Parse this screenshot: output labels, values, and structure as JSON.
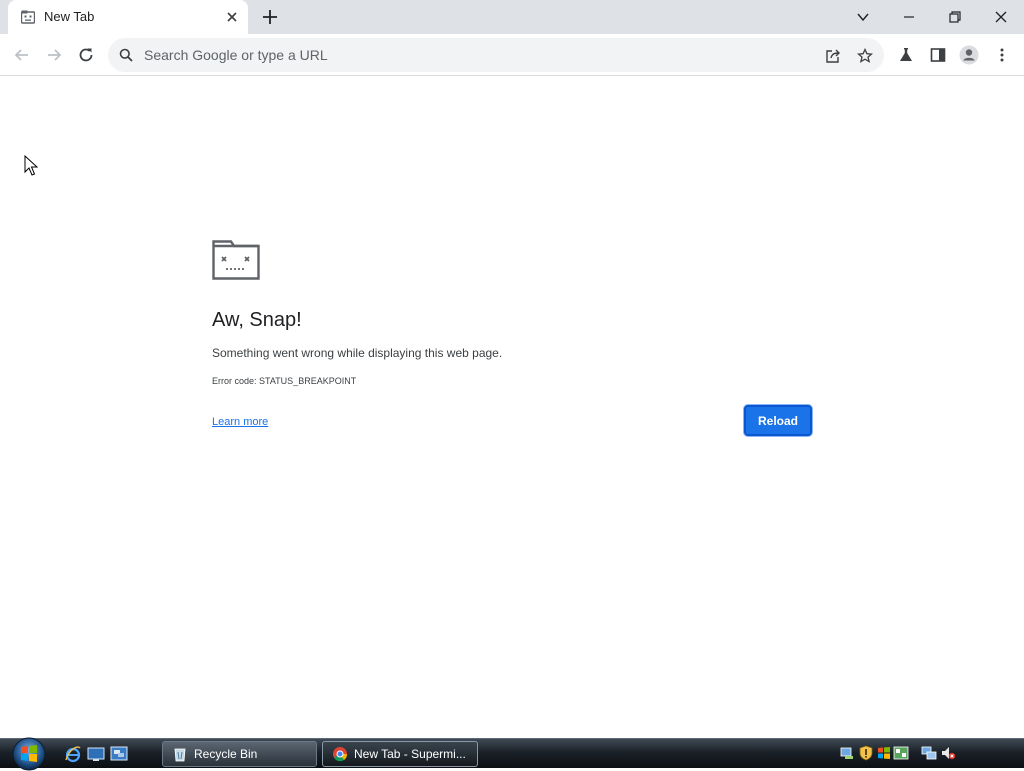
{
  "browser": {
    "tab": {
      "title": "New Tab"
    },
    "omnibox": {
      "placeholder": "Search Google or type a URL"
    }
  },
  "error_page": {
    "title": "Aw, Snap!",
    "message": "Something went wrong while displaying this web page.",
    "error_code": "Error code: STATUS_BREAKPOINT",
    "learn_more": "Learn more",
    "reload": "Reload"
  },
  "taskbar": {
    "buttons": [
      {
        "label": "Recycle Bin",
        "icon": "recycle-bin-icon"
      },
      {
        "label": "New Tab - Supermi...",
        "icon": "chrome-icon"
      }
    ]
  },
  "colors": {
    "accent": "#1a73e8",
    "tabstrip": "#dee1e6",
    "omnibox": "#f1f3f4"
  }
}
